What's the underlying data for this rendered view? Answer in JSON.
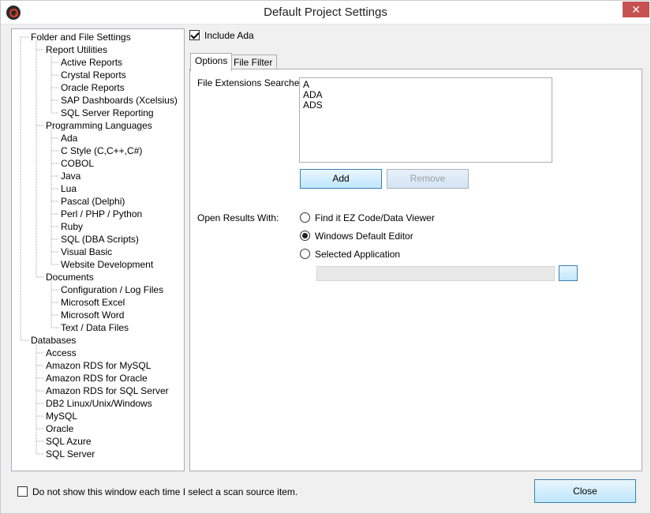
{
  "window": {
    "title": "Default Project Settings",
    "close_glyph": "✕"
  },
  "tree": {
    "nodes": [
      {
        "label": "Folder and File Settings",
        "level": 0
      },
      {
        "label": "Report Utilities",
        "level": 1
      },
      {
        "label": "Active Reports",
        "level": 2
      },
      {
        "label": "Crystal Reports",
        "level": 2
      },
      {
        "label": "Oracle Reports",
        "level": 2
      },
      {
        "label": "SAP Dashboards (Xcelsius)",
        "level": 2
      },
      {
        "label": "SQL Server Reporting",
        "level": 2
      },
      {
        "label": "Programming Languages",
        "level": 1
      },
      {
        "label": "Ada",
        "level": 2
      },
      {
        "label": "C Style (C,C++,C#)",
        "level": 2
      },
      {
        "label": "COBOL",
        "level": 2
      },
      {
        "label": "Java",
        "level": 2
      },
      {
        "label": "Lua",
        "level": 2
      },
      {
        "label": "Pascal (Delphi)",
        "level": 2
      },
      {
        "label": "Perl / PHP / Python",
        "level": 2
      },
      {
        "label": "Ruby",
        "level": 2
      },
      {
        "label": "SQL (DBA Scripts)",
        "level": 2
      },
      {
        "label": "Visual Basic",
        "level": 2
      },
      {
        "label": "Website Development",
        "level": 2
      },
      {
        "label": "Documents",
        "level": 1
      },
      {
        "label": "Configuration / Log Files",
        "level": 2
      },
      {
        "label": "Microsoft Excel",
        "level": 2
      },
      {
        "label": "Microsoft Word",
        "level": 2
      },
      {
        "label": "Text / Data Files",
        "level": 2
      },
      {
        "label": "Databases",
        "level": 0
      },
      {
        "label": "Access",
        "level": 1
      },
      {
        "label": "Amazon RDS for MySQL",
        "level": 1
      },
      {
        "label": "Amazon RDS for Oracle",
        "level": 1
      },
      {
        "label": "Amazon RDS for SQL Server",
        "level": 1
      },
      {
        "label": "DB2 Linux/Unix/Windows",
        "level": 1
      },
      {
        "label": "MySQL",
        "level": 1
      },
      {
        "label": "Oracle",
        "level": 1
      },
      {
        "label": "SQL Azure",
        "level": 1
      },
      {
        "label": "SQL Server",
        "level": 1
      }
    ]
  },
  "include": {
    "label": "Include Ada",
    "checked": true
  },
  "tabs": [
    {
      "label": "Options",
      "active": true
    },
    {
      "label": "File Filter",
      "active": false
    }
  ],
  "options": {
    "extensions_label": "File Extensions Searched:",
    "extensions": [
      "A",
      "ADA",
      "ADS"
    ],
    "add_label": "Add",
    "remove_label": "Remove",
    "open_with_label": "Open Results With:",
    "radios": [
      {
        "label": "Find it EZ Code/Data Viewer",
        "selected": false
      },
      {
        "label": "Windows Default Editor",
        "selected": true
      },
      {
        "label": "Selected Application",
        "selected": false
      }
    ],
    "application_path": ""
  },
  "footer": {
    "dont_show_label": "Do not show this window each time I select a scan source item.",
    "dont_show_checked": false,
    "close_label": "Close"
  }
}
